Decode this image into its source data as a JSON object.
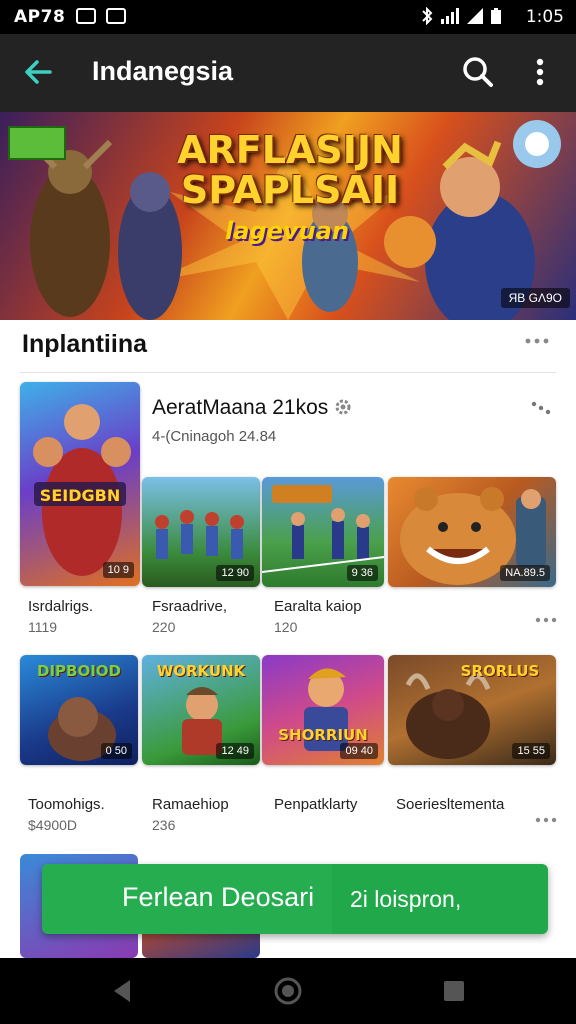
{
  "status_bar": {
    "left_time": "AP78",
    "clock": "1:05"
  },
  "app_bar": {
    "title": "Indanegsia"
  },
  "banner": {
    "title": "ARFLASIJN SPAPLSAII",
    "subtitle": "lagevuan",
    "tag": "ЯB GΛ9O",
    "badge": ""
  },
  "section": {
    "title": "Inplantiina"
  },
  "featured": {
    "title": "AeratMaana 21kos",
    "subtitle": "4-(Cninagoh 24.84"
  },
  "row1": [
    {
      "name": "Isrdalrigs.",
      "sub": "1119",
      "rating": "10 9",
      "art_text": "SEIDGBN"
    },
    {
      "name": "Fsraadrive,",
      "sub": "220",
      "rating": "12 90",
      "art_text": ""
    },
    {
      "name": "Earalta kaiop",
      "sub": "120",
      "rating": "9 36",
      "art_text": ""
    },
    {
      "name": "",
      "sub": "",
      "rating": "NA.89.5",
      "art_text": ""
    }
  ],
  "row2": [
    {
      "name": "Toomohigs.",
      "sub": "$4900D",
      "rating": "0 50",
      "art_text": "DIPBOIOD"
    },
    {
      "name": "Ramaehiop",
      "sub": "236",
      "rating": "12 49",
      "art_text": "WORKUNK"
    },
    {
      "name": "Penpatklarty",
      "sub": "",
      "rating": "09 40",
      "art_text": "SHORRIUN"
    },
    {
      "name": "Soeriesltementa",
      "sub": "",
      "rating": "15 55",
      "art_text": "SRORLUS"
    }
  ],
  "cta": {
    "label_left": "Ferlean Deosari",
    "label_right": "2i loispron,"
  },
  "colors": {
    "accent": "#3ecfc0",
    "cta_green": "#20a84a",
    "app_bar": "#222322"
  }
}
